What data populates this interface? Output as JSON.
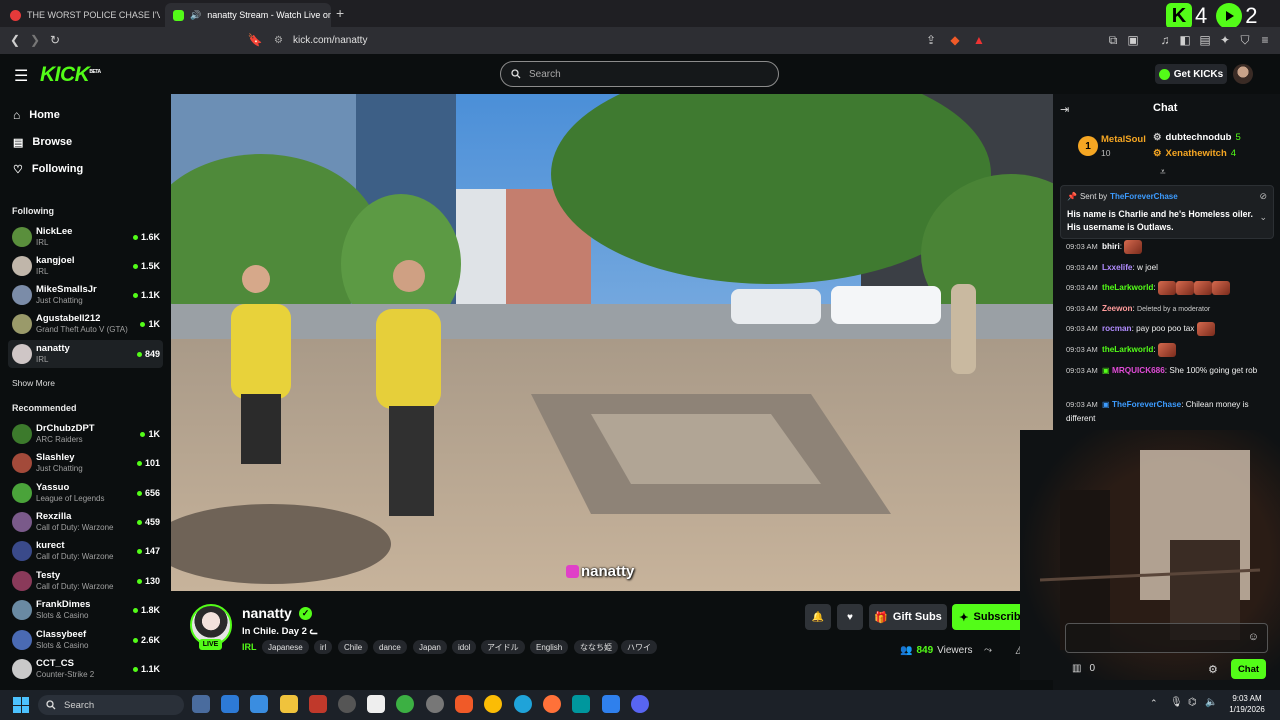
{
  "browser": {
    "tabs": [
      {
        "title": "THE WORST POLICE CHASE I'VE EVER"
      },
      {
        "title": "nanatty Stream - Watch Live on"
      }
    ],
    "url": "kick.com/nanatty",
    "ext_counts": [
      "4",
      "2"
    ]
  },
  "header": {
    "logo": "KICK",
    "logo_badge": "BETA",
    "search_placeholder": "Search",
    "get_kicks": "Get KICKs"
  },
  "sidebar": {
    "nav": [
      {
        "label": "Home",
        "icon": "home-icon"
      },
      {
        "label": "Browse",
        "icon": "browse-icon"
      },
      {
        "label": "Following",
        "icon": "heart-icon"
      }
    ],
    "following_title": "Following",
    "following": [
      {
        "name": "NickLee",
        "category": "IRL",
        "viewers": "1.6K",
        "color": "#5a8f3c"
      },
      {
        "name": "kangjoel",
        "category": "IRL",
        "viewers": "1.5K",
        "color": "#c0b6aa"
      },
      {
        "name": "MikeSmallsJr",
        "category": "Just Chatting",
        "viewers": "1.1K",
        "color": "#7b8ca8"
      },
      {
        "name": "Agustabell212",
        "category": "Grand Theft Auto V (GTA)",
        "viewers": "1K",
        "color": "#9a9a6a"
      },
      {
        "name": "nanatty",
        "category": "IRL",
        "viewers": "849",
        "color": "#cfc6c6"
      }
    ],
    "show_more": "Show More",
    "recommended_title": "Recommended",
    "recommended": [
      {
        "name": "DrChubzDPT",
        "category": "ARC Raiders",
        "viewers": "1K",
        "color": "#3c7a2c"
      },
      {
        "name": "Slashley",
        "category": "Just Chatting",
        "viewers": "101",
        "color": "#a34a3a"
      },
      {
        "name": "Yassuo",
        "category": "League of Legends",
        "viewers": "656",
        "color": "#4aa33a"
      },
      {
        "name": "Rexzilla",
        "category": "Call of Duty: Warzone",
        "viewers": "459",
        "color": "#7a5a8a"
      },
      {
        "name": "kurect",
        "category": "Call of Duty: Warzone",
        "viewers": "147",
        "color": "#3a4a8a"
      },
      {
        "name": "Testy",
        "category": "Call of Duty: Warzone",
        "viewers": "130",
        "color": "#8a3a5a"
      },
      {
        "name": "FrankDimes",
        "category": "Slots & Casino",
        "viewers": "1.8K",
        "color": "#6a8aa3"
      },
      {
        "name": "Classybeef",
        "category": "Slots & Casino",
        "viewers": "2.6K",
        "color": "#4a6ab3"
      },
      {
        "name": "CCT_CS",
        "category": "Counter-Strike 2",
        "viewers": "1.1K",
        "color": "#c9c9c9"
      }
    ]
  },
  "video": {
    "watermark": "nanatty"
  },
  "stream": {
    "name": "nanatty",
    "live": "LIVE",
    "title": "In Chile. Day 2 ᓚ",
    "category": "IRL",
    "tags": [
      "Japanese",
      "irl",
      "Chile",
      "dance",
      "Japan",
      "idol",
      "アイドル",
      "English",
      "ななち姫",
      "ハワイ"
    ],
    "gift_subs": "Gift Subs",
    "subscribe": "Subscribe",
    "viewers_count": "849",
    "viewers_label": "Viewers"
  },
  "chat": {
    "title": "Chat",
    "leaderboard": [
      {
        "rank": "1",
        "name": "MetalSoul",
        "count": "10",
        "color": "#f5a623"
      },
      {
        "name": "dubtechnodub",
        "count": "5",
        "color": "#ffffff"
      },
      {
        "name": "Xenathewitch",
        "count": "4",
        "color": "#f5a623"
      }
    ],
    "pinned": {
      "sent_by_label": "Sent by",
      "sender": "TheForeverChase",
      "text": "His name is Charlie and he's Homeless oiler. His username is Outlaws."
    },
    "messages": [
      {
        "time": "09:03 AM",
        "user": "bhiri",
        "text": "",
        "color": "#ffffff"
      },
      {
        "time": "09:03 AM",
        "user": "Lxxelife",
        "text": "w joel",
        "color": "#b18cff"
      },
      {
        "time": "09:03 AM",
        "user": "theLarkworld",
        "text": "",
        "color": "#53fc18"
      },
      {
        "time": "09:03 AM",
        "user": "Zeewon",
        "text": "Deleted by a moderator",
        "color": "#ff9b9b"
      },
      {
        "time": "09:03 AM",
        "user": "rocman",
        "text": "pay poo poo tax",
        "color": "#b18cff"
      },
      {
        "time": "09:03 AM",
        "user": "theLarkworld",
        "text": "",
        "color": "#53fc18"
      },
      {
        "time": "09:03 AM",
        "user": "MRQUICK686",
        "text": "She 100% going get rob",
        "color": "#e04bd6"
      },
      {
        "time": "09:03 AM",
        "user": "TheForeverChase",
        "text": "Chilean money is different",
        "color": "#3d9cff"
      }
    ],
    "points": "0",
    "send_label": "Chat"
  },
  "taskbar": {
    "search": "Search",
    "time": "9:03 AM",
    "date": "1/19/2026"
  }
}
